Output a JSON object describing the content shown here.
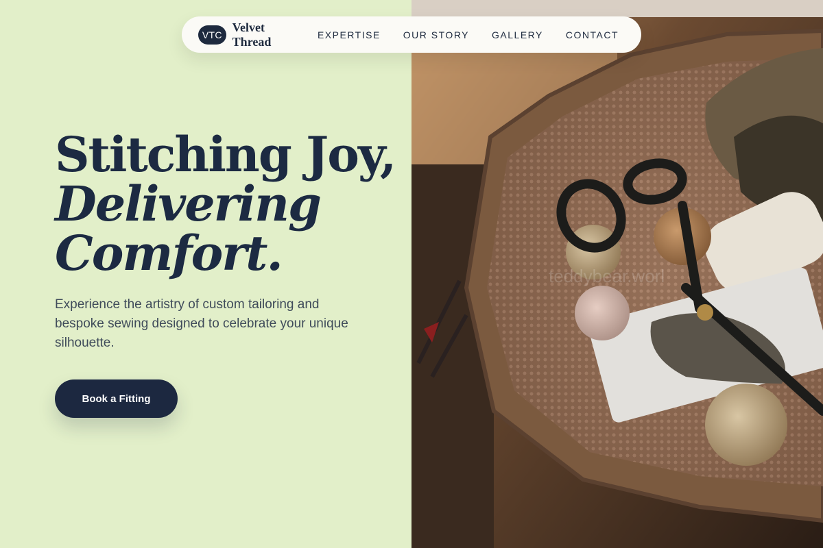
{
  "nav": {
    "logo_badge": "VTC",
    "brand": "Velvet Thread",
    "links": [
      "EXPERTISE",
      "OUR STORY",
      "GALLERY",
      "CONTACT"
    ]
  },
  "hero": {
    "headline_line1": "Stitching Joy,",
    "headline_line2": "Delivering",
    "headline_line3": "Comfort.",
    "subtext": "Experience the artistry of custom tailoring and bespoke sewing designed to celebrate your unique silhouette.",
    "cta_label": "Book a Fitting"
  },
  "photo": {
    "watermark": "teddybear.worl"
  },
  "colors": {
    "left_background": "#e2efc9",
    "navy": "#1c2a42",
    "nav_background": "#fbfaf6"
  }
}
